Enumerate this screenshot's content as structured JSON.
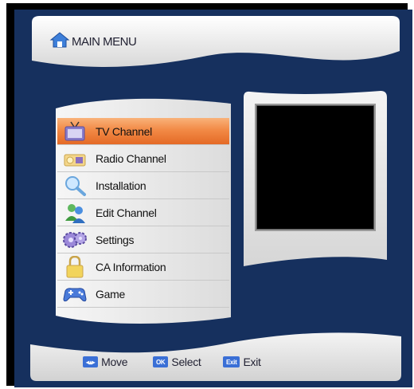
{
  "header": {
    "title": "MAIN MENU",
    "icon": "home-icon"
  },
  "menu": {
    "selected_index": 0,
    "items": [
      {
        "label": "TV Channel",
        "icon": "tv-icon"
      },
      {
        "label": "Radio Channel",
        "icon": "radio-icon"
      },
      {
        "label": "Installation",
        "icon": "magnifier-icon"
      },
      {
        "label": "Edit Channel",
        "icon": "users-icon"
      },
      {
        "label": "Settings",
        "icon": "gears-icon"
      },
      {
        "label": "CA Information",
        "icon": "lock-icon"
      },
      {
        "label": "Game",
        "icon": "gamepad-icon"
      }
    ]
  },
  "footer": {
    "move": {
      "key": "◂▴▸",
      "label": "Move"
    },
    "select": {
      "key": "OK",
      "label": "Select"
    },
    "exit": {
      "key": "Exit",
      "label": "Exit"
    }
  },
  "colors": {
    "background": "#16305e",
    "highlight": "#f28a46",
    "panel": "#eeeeee",
    "key_badge": "#3a6fd6"
  }
}
